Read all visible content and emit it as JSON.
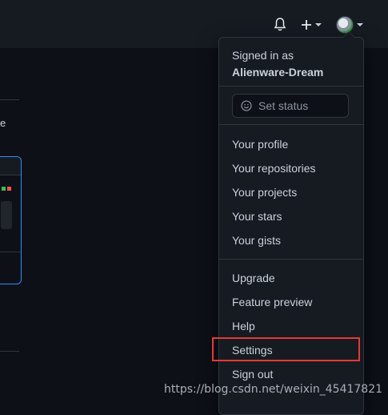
{
  "header": {
    "notifications_icon": "bell-icon",
    "create_icon": "plus-icon",
    "avatar_icon": "avatar-icon"
  },
  "menu": {
    "signed_in_label": "Signed in as",
    "username": "Alienware-Dream",
    "set_status": "Set status",
    "profile_items": [
      "Your profile",
      "Your repositories",
      "Your projects",
      "Your stars",
      "Your gists"
    ],
    "upgrade": "Upgrade",
    "feature_preview": "Feature preview",
    "help": "Help",
    "settings": "Settings",
    "sign_out": "Sign out"
  },
  "background": {
    "partial_letter": "e"
  },
  "watermark": "https://blog.csdn.net/weixin_45417821",
  "colors": {
    "background": "#0d1117",
    "header": "#161b22",
    "menu": "#161b22",
    "highlight_border": "#e53935",
    "card_border": "#388bfd"
  }
}
